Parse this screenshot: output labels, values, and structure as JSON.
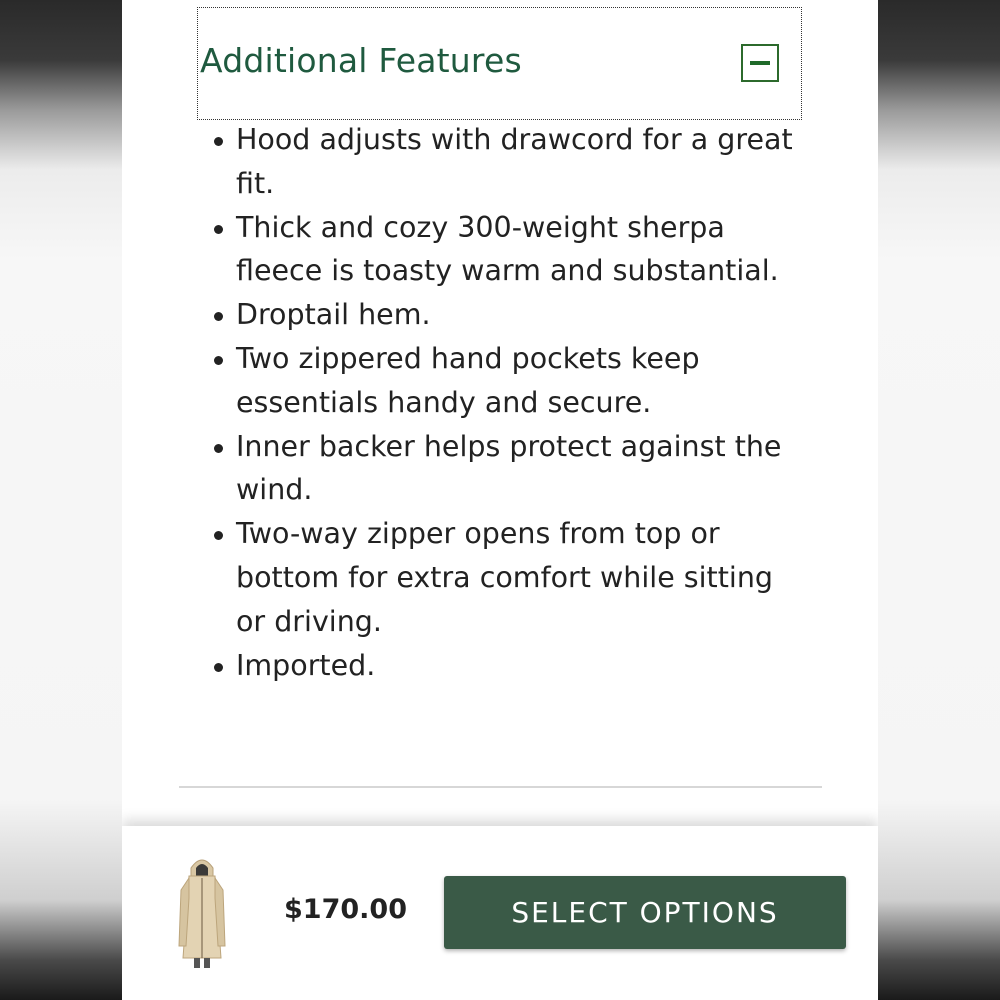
{
  "accordion": {
    "title": "Additional Features",
    "icon": "minus-icon",
    "accent_color": "#1f5a3f"
  },
  "features": [
    "Hood adjusts with drawcord for a great fit.",
    "Thick and cozy 300-weight sherpa fleece is toasty warm and substantial.",
    "Droptail hem.",
    "Two zippered hand pockets keep essentials handy and secure.",
    "Inner backer helps protect against the wind.",
    "Two-way zipper opens from top or bottom for extra comfort while sitting or driving.",
    "Imported."
  ],
  "purchase_bar": {
    "price": "$170.00",
    "button_label": "SELECT OPTIONS",
    "button_color": "#3a5a47"
  }
}
